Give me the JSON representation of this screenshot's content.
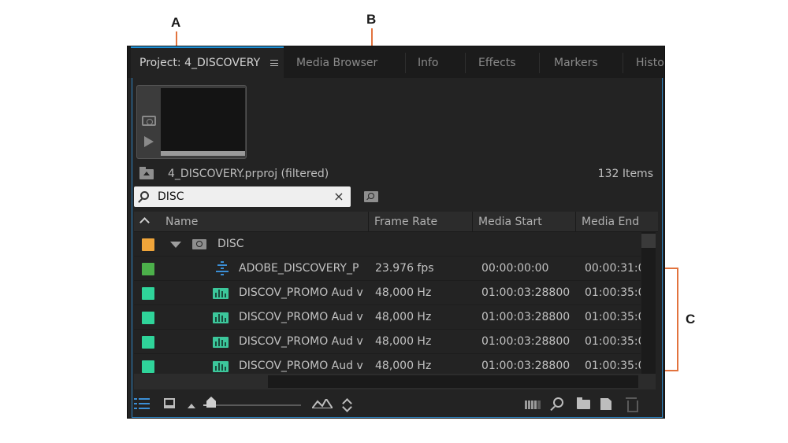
{
  "callouts": {
    "a": "A",
    "b": "B",
    "c": "C"
  },
  "tabs": [
    {
      "label": "Project: 4_DISCOVERY",
      "active": true
    },
    {
      "label": "Media Browser",
      "active": false
    },
    {
      "label": "Info",
      "active": false
    },
    {
      "label": "Effects",
      "active": false
    },
    {
      "label": "Markers",
      "active": false
    },
    {
      "label": "Histo",
      "active": false
    }
  ],
  "project": {
    "file_label": "4_DISCOVERY.prproj (filtered)",
    "item_count": "132 Items"
  },
  "search": {
    "value": "DISC",
    "clear_glyph": "×"
  },
  "columns": [
    "Name",
    "Frame Rate",
    "Media Start",
    "Media End"
  ],
  "rows": [
    {
      "kind": "bin",
      "color": "#f0a53a",
      "name": "DISC",
      "frame_rate": "",
      "media_start": "",
      "media_end": ""
    },
    {
      "kind": "sequence",
      "color": "#4cb04a",
      "name": "ADOBE_DISCOVERY_P",
      "frame_rate": "23.976 fps",
      "media_start": "00:00:00:00",
      "media_end": "00:00:31:0"
    },
    {
      "kind": "audio",
      "color": "#2fd49a",
      "name": "DISCOV_PROMO Aud v",
      "frame_rate": "48,000 Hz",
      "media_start": "01:00:03:28800",
      "media_end": "01:00:35:0"
    },
    {
      "kind": "audio",
      "color": "#2fd49a",
      "name": "DISCOV_PROMO Aud v",
      "frame_rate": "48,000 Hz",
      "media_start": "01:00:03:28800",
      "media_end": "01:00:35:0"
    },
    {
      "kind": "audio",
      "color": "#2fd49a",
      "name": "DISCOV_PROMO Aud v",
      "frame_rate": "48,000 Hz",
      "media_start": "01:00:03:28800",
      "media_end": "01:00:35:0"
    },
    {
      "kind": "audio",
      "color": "#2fd49a",
      "name": "DISCOV_PROMO Aud v",
      "frame_rate": "48,000 Hz",
      "media_start": "01:00:03:28800",
      "media_end": "01:00:35:0"
    }
  ],
  "icons": {
    "panel_menu": "hamburger-icon",
    "poster": "camera-icon",
    "play": "play-icon",
    "parent_folder": "folder-up-icon",
    "search": "magnifier-icon",
    "bin_search": "bin-search-icon",
    "footer": [
      "list-view-icon",
      "icon-view-icon",
      "zoom-small-icon",
      "zoom-large-icon",
      "sort-icon",
      "automate-icon",
      "find-icon",
      "new-bin-icon",
      "new-item-icon",
      "clear-icon"
    ]
  },
  "zoom_level": 0.05,
  "accent_color": "#1e90d6",
  "callout_color": "#e2733e"
}
